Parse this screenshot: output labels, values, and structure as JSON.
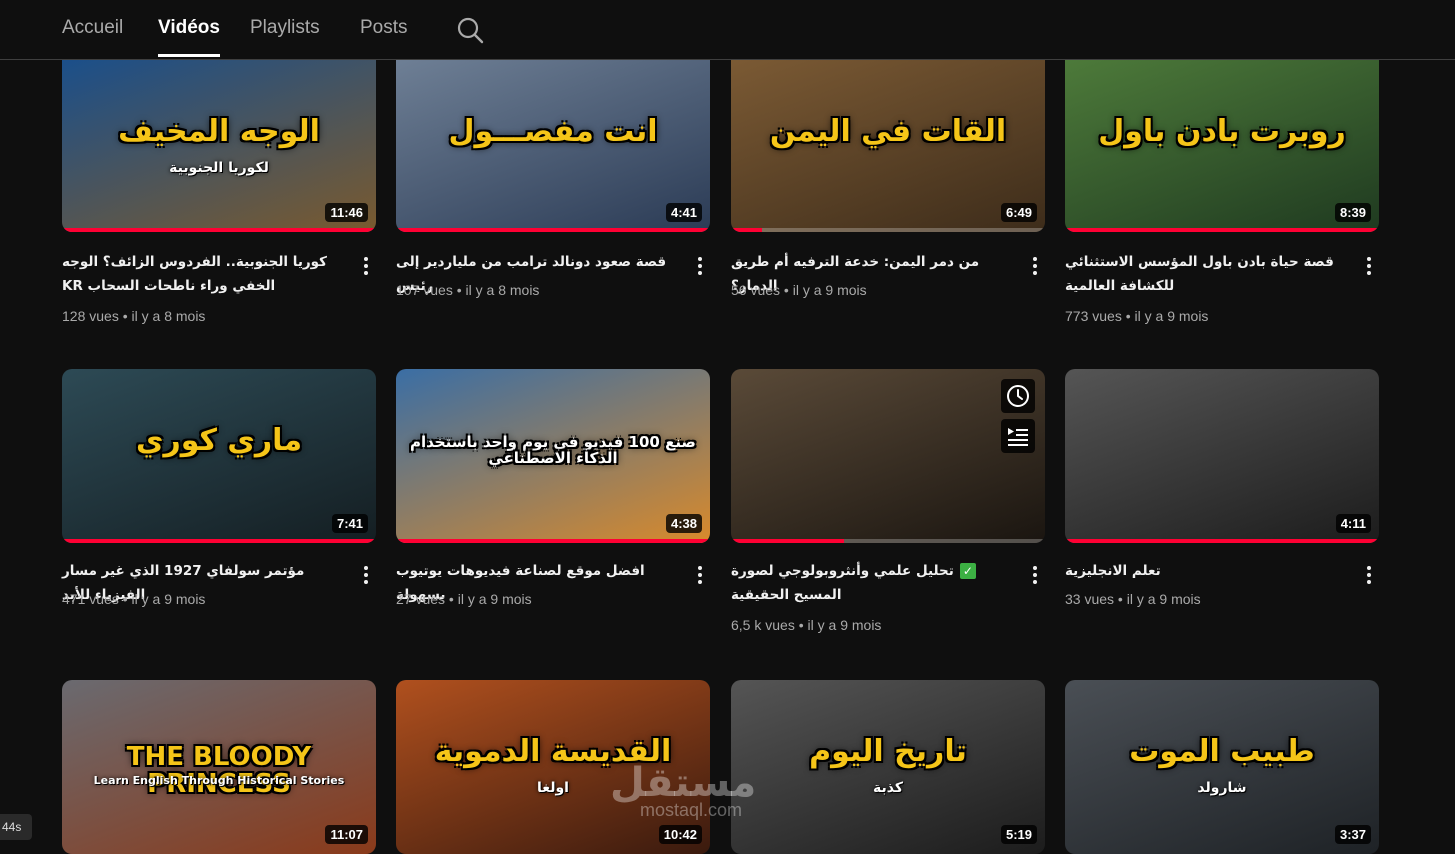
{
  "tabs": [
    "Accueil",
    "Vidéos",
    "Playlists",
    "Posts"
  ],
  "active_tab": "Vidéos",
  "status_corner": "44s",
  "watermark": {
    "main": "مستقل",
    "sub": "mostaql.com"
  },
  "videos": [
    {
      "thumb_title": "الوجه المخيف",
      "thumb_sub": "لكوريا الجنوبية",
      "duration": "11:46",
      "progress": 1.0,
      "title": "كوريا الجنوبية.. الفردوس الزائف؟ الوجه الخفي وراء ناطحات السحاب KR",
      "views": "128 vues",
      "age": "il y a 8 mois",
      "colors": [
        "#1b4f8a",
        "#7a5a2e"
      ]
    },
    {
      "thumb_title": "انت مفصـــول",
      "thumb_sub": "",
      "duration": "4:41",
      "progress": 1.0,
      "title": "قصة صعود دونالد ترامب من ملياردير إلى رئيس",
      "views": "107 vues",
      "age": "il y a 8 mois",
      "colors": [
        "#6e7f95",
        "#2b3b55"
      ]
    },
    {
      "thumb_title": "القات في اليمن",
      "thumb_sub": "",
      "duration": "6:49",
      "progress": 0.1,
      "title": "من دمر اليمن: خدعة الترفيه أم طريق الدمار؟",
      "views": "56 vues",
      "age": "il y a 9 mois",
      "colors": [
        "#7b5a34",
        "#3d2c1a"
      ]
    },
    {
      "thumb_title": "روبرت بادن باول",
      "thumb_sub": "",
      "duration": "8:39",
      "progress": 1.0,
      "title": "قصة حياة بادن باول المؤسس الاستثنائي للكشافة العالمية",
      "views": "773 vues",
      "age": "il y a 9 mois",
      "colors": [
        "#4d7a3a",
        "#1f3a20"
      ]
    },
    {
      "thumb_title": "ماري كوري",
      "thumb_sub": "",
      "duration": "7:41",
      "progress": 1.0,
      "title": "مؤتمر سولفاي 1927 الذي غير مسار الفيزياء للأبد",
      "views": "471 vues",
      "age": "il y a 9 mois",
      "colors": [
        "#2d4a55",
        "#141e22"
      ]
    },
    {
      "thumb_title": "صنع 100 فيديو في يوم واحد باستخدام الذكاء الاصطناعي",
      "thumb_sub": "",
      "duration": "4:38",
      "progress": 1.0,
      "title": "افضل موقع لصناعة فيديوهات يوتيوب بسهولة",
      "views": "27 vues",
      "age": "il y a 9 mois",
      "colors": [
        "#3a6ea5",
        "#d98a2b"
      ]
    },
    {
      "thumb_title": "",
      "thumb_sub": "",
      "duration": "",
      "progress": 0.36,
      "title": "تحليل علمي وأنثروبولوجي لصورة المسيح الحقيقية",
      "views": "6,5 k vues",
      "age": "il y a 9 mois",
      "colors": [
        "#5a4a38",
        "#1a1510"
      ],
      "check": true
    },
    {
      "thumb_title": "",
      "thumb_sub": "",
      "duration": "4:11",
      "progress": 1.0,
      "title": "تعلم الانجليزية",
      "views": "33 vues",
      "age": "il y a 9 mois",
      "colors": [
        "#555555",
        "#1c1c1c"
      ]
    },
    {
      "thumb_title": "THE BLOODY PRINCESS",
      "thumb_sub": "Learn English Through Historical Stories",
      "duration": "11:07",
      "progress": 0,
      "title": "",
      "views": "",
      "age": "",
      "colors": [
        "#6a6a70",
        "#8a3a1a"
      ]
    },
    {
      "thumb_title": "القديسة الدموية",
      "thumb_sub": "اولغا",
      "duration": "10:42",
      "progress": 0,
      "title": "",
      "views": "",
      "age": "",
      "colors": [
        "#b0501e",
        "#3a1a0e"
      ]
    },
    {
      "thumb_title": "تاريخ اليوم",
      "thumb_sub": "كذبة",
      "duration": "5:19",
      "progress": 0,
      "title": "",
      "views": "",
      "age": "",
      "colors": [
        "#555555",
        "#1c1c1c"
      ]
    },
    {
      "thumb_title": "طبيب الموت",
      "thumb_sub": "شارولد",
      "duration": "3:37",
      "progress": 0,
      "title": "",
      "views": "",
      "age": "",
      "colors": [
        "#4a4f55",
        "#1e2226"
      ]
    }
  ]
}
